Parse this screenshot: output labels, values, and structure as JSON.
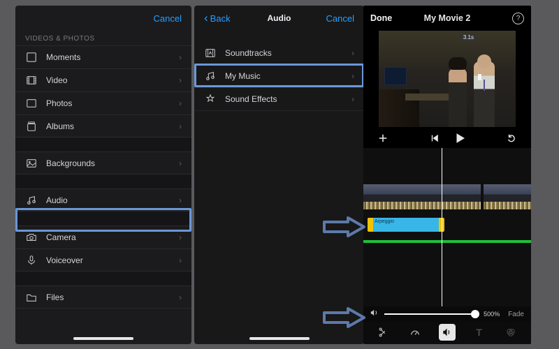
{
  "media_panel": {
    "cancel": "Cancel",
    "section_videos_photos": "VIDEOS & PHOTOS",
    "items_vp": [
      {
        "label": "Moments",
        "icon": "moments"
      },
      {
        "label": "Video",
        "icon": "video"
      },
      {
        "label": "Photos",
        "icon": "photos"
      },
      {
        "label": "Albums",
        "icon": "albums"
      }
    ],
    "items_bg": [
      {
        "label": "Backgrounds",
        "icon": "backgrounds"
      }
    ],
    "items_audio": [
      {
        "label": "Audio",
        "icon": "audio"
      }
    ],
    "items_cam": [
      {
        "label": "Camera",
        "icon": "camera"
      },
      {
        "label": "Voiceover",
        "icon": "voiceover"
      }
    ],
    "items_files": [
      {
        "label": "Files",
        "icon": "files"
      }
    ],
    "highlight": "Audio"
  },
  "audio_panel": {
    "back": "Back",
    "title": "Audio",
    "cancel": "Cancel",
    "items": [
      {
        "label": "Soundtracks",
        "icon": "soundtracks"
      },
      {
        "label": "My Music",
        "icon": "mymusic"
      },
      {
        "label": "Sound Effects",
        "icon": "soundeffects"
      }
    ],
    "highlight": "My Music"
  },
  "editor_panel": {
    "done": "Done",
    "title": "My Movie 2",
    "preview_time_badge": "3.1s",
    "audio_clip_label": "Arpeggio",
    "volume_percent": "500%",
    "fade_label": "Fade"
  }
}
